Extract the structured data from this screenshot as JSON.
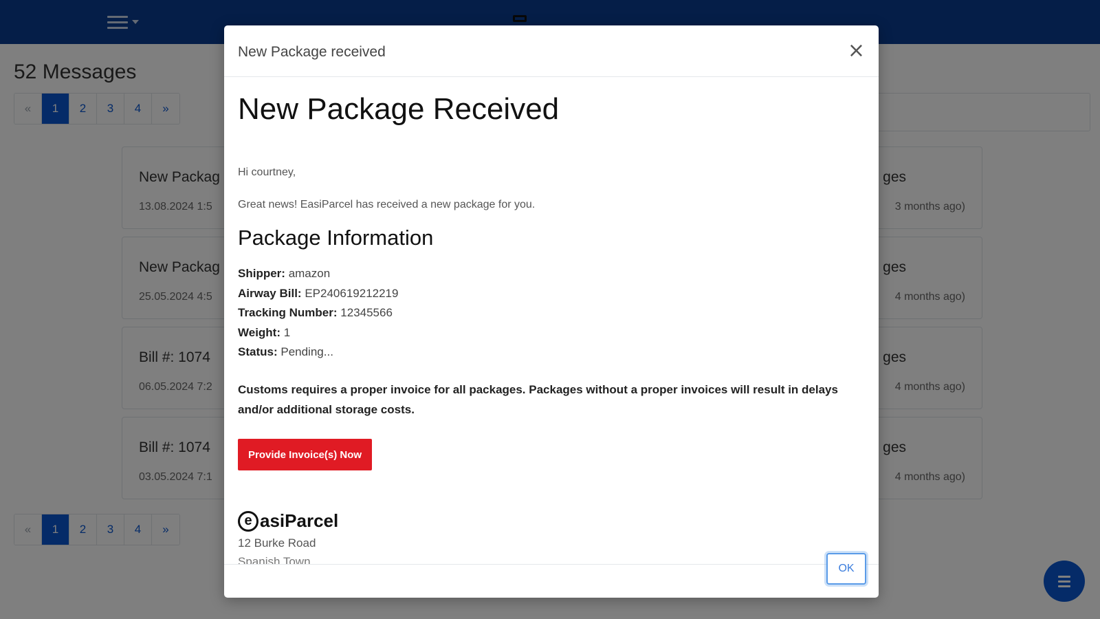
{
  "header": {
    "menu_icon": "hamburger-icon",
    "brand_icon": "laptop-icon"
  },
  "page": {
    "title": "52 Messages",
    "pagination": {
      "prev": "«",
      "next": "»",
      "pages": [
        "1",
        "2",
        "3",
        "4"
      ],
      "active": "1"
    }
  },
  "messages": [
    {
      "title": "New Packag",
      "date": "13.08.2024 1:5",
      "right_title": "ges",
      "ago": "3 months ago)"
    },
    {
      "title": "New Packag",
      "date": "25.05.2024 4:5",
      "right_title": "ges",
      "ago": "4 months ago)"
    },
    {
      "title": "Bill #: 1074",
      "date": "06.05.2024 7:2",
      "right_title": "ges",
      "ago": "4 months ago)"
    },
    {
      "title": "Bill #: 1074",
      "date": "03.05.2024 7:1",
      "right_title": "ges",
      "ago": "4 months ago)"
    }
  ],
  "modal": {
    "title": "New Package received",
    "close_label": "×",
    "heading": "New Package Received",
    "greeting": "Hi courtney,",
    "intro": "Great news! EasiParcel has received a new package for you.",
    "info_heading": "Package Information",
    "fields": [
      {
        "label": "Shipper:",
        "value": "amazon"
      },
      {
        "label": "Airway Bill:",
        "value": "EP240619212219"
      },
      {
        "label": "Tracking Number:",
        "value": "12345566"
      },
      {
        "label": "Weight:",
        "value": "1"
      },
      {
        "label": "Status:",
        "value": "Pending..."
      }
    ],
    "notice": "Customs requires a proper invoice for all packages. Packages without a proper invoices will result in delays and/or additional storage costs.",
    "cta_label": "Provide Invoice(s) Now",
    "logo_e": "e",
    "logo_text": "asiParcel",
    "address": [
      "12 Burke Road",
      "Spanish Town"
    ],
    "ok_label": "OK"
  },
  "fab": {
    "icon": "list-icon"
  },
  "colors": {
    "topbar": "#0b3d91",
    "primary": "#0b57d0",
    "cta": "#e01b24"
  }
}
